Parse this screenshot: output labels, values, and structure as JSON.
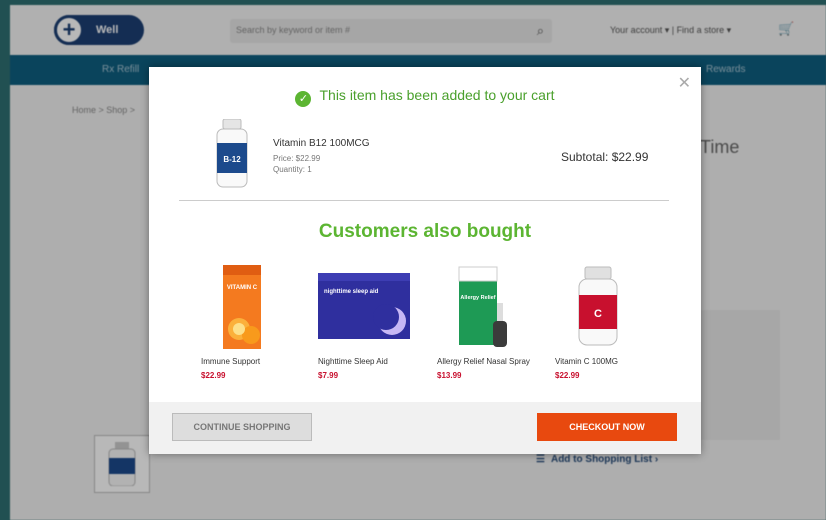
{
  "header": {
    "logo_text": "Well",
    "search_placeholder": "Search by keyword or item #",
    "account_links": "Your account ▾  |  Find a store ▾"
  },
  "nav": {
    "left_item": "Rx Refill",
    "right_item": "Rewards"
  },
  "breadcrumb": "Home >  Shop >",
  "background": {
    "title_fragment": "Time",
    "add_to_list": "Add to Shopping List"
  },
  "modal": {
    "added_message": "This item has been added to your cart",
    "item": {
      "name": "Vitamin B12 100MCG",
      "price": "Price: $22.99",
      "quantity": "Quantity: 1",
      "bottle_label": "B-12"
    },
    "subtotal": "Subtotal: $22.99",
    "also_bought_title": "Customers also bought",
    "products": [
      {
        "name": "Immune Support",
        "price": "$22.99",
        "box_label": "VITAMIN C"
      },
      {
        "name": "Nighttime Sleep Aid",
        "price": "$7.99",
        "box_label": "nighttime sleep aid"
      },
      {
        "name": "Allergy Relief Nasal Spray",
        "price": "$13.99",
        "box_label": "Allergy Relief"
      },
      {
        "name": "Vitamin C 100MG",
        "price": "$22.99",
        "bottle_label": "C"
      }
    ],
    "continue_label": "CONTINUE SHOPPING",
    "checkout_label": "CHECKOUT NOW"
  },
  "colors": {
    "accent_green": "#5cb532",
    "checkout_orange": "#e8490f",
    "price_red": "#c8102e",
    "nav_blue": "#0f5f80"
  }
}
